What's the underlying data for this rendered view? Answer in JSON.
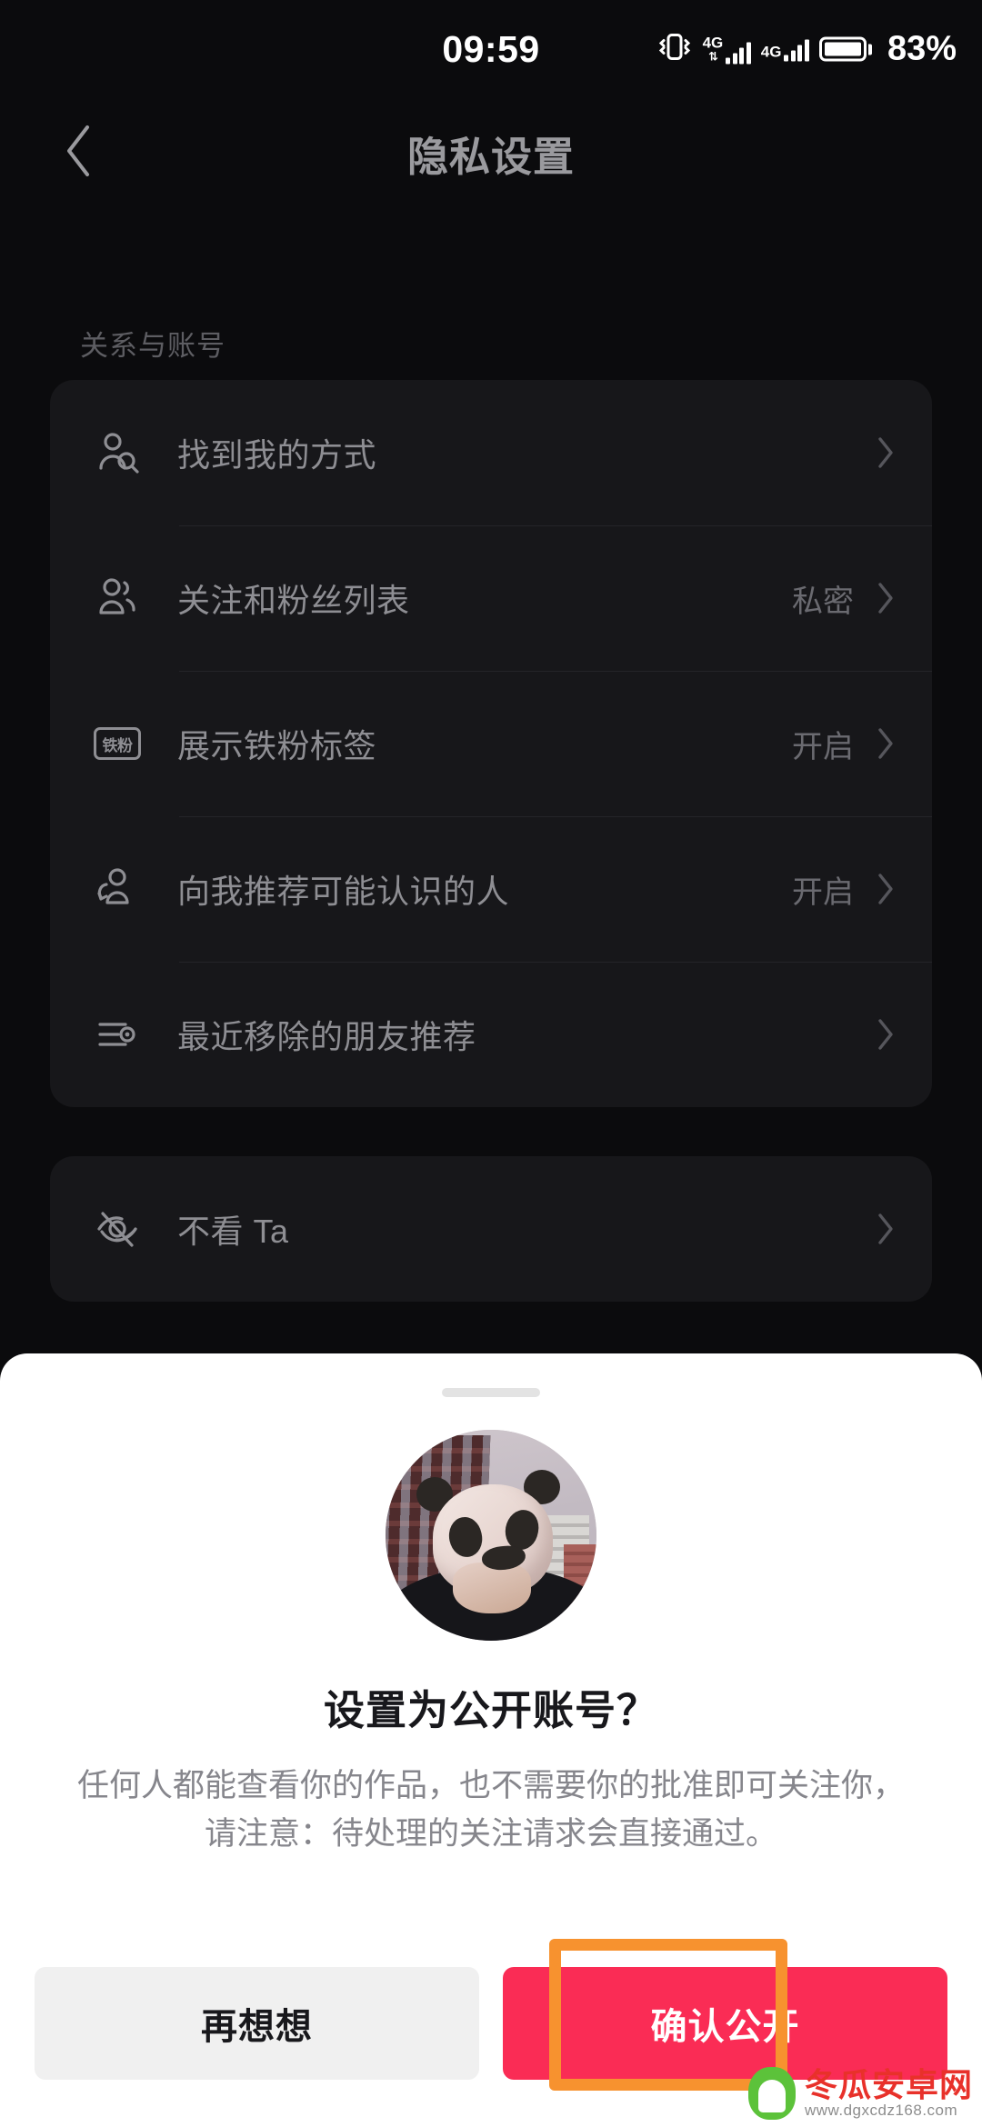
{
  "status_bar": {
    "clock": "09:59",
    "battery_percent": "83%",
    "sim1_network": "4G",
    "sim2_network": "4G",
    "icons": [
      "vibrate-icon",
      "signal-icon",
      "signal-icon",
      "battery-icon"
    ]
  },
  "nav": {
    "back_icon": "chevron-left-icon",
    "title": "隐私设置"
  },
  "sections": [
    {
      "label": "关系与账号",
      "rows": [
        {
          "icon": "person-search-icon",
          "label": "找到我的方式",
          "value": ""
        },
        {
          "icon": "people-group-icon",
          "label": "关注和粉丝列表",
          "value": "私密"
        },
        {
          "icon": "fan-badge-icon",
          "badge_text": "铁粉",
          "label": "展示铁粉标签",
          "value": "开启"
        },
        {
          "icon": "person-suggest-icon",
          "label": "向我推荐可能认识的人",
          "value": "开启"
        },
        {
          "icon": "list-settings-icon",
          "label": "最近移除的朋友推荐",
          "value": ""
        }
      ]
    },
    {
      "label": "",
      "rows": [
        {
          "icon": "eye-off-icon",
          "label": "不看 Ta",
          "value": ""
        }
      ]
    }
  ],
  "sheet": {
    "handle": "drag-handle",
    "avatar_alt": "panda-mask-avatar",
    "title": "设置为公开账号？",
    "body": "任何人都能查看你的作品，也不需要你的批准即可关注你，请注意：待处理的关注请求会直接通过。",
    "secondary_button": "再想想",
    "primary_button": "确认公开"
  },
  "annotation": {
    "highlight_color": "#f7922f",
    "target": "确认公开"
  },
  "watermark": {
    "name": "冬瓜安卓网",
    "url": "www.dgxcdz168.com"
  },
  "colors": {
    "page_bg": "#0b0b0d",
    "card_bg": "#17171a",
    "text_muted": "#8e8e93",
    "primary_red": "#fa2c55",
    "accent_orange": "#f7922f"
  }
}
